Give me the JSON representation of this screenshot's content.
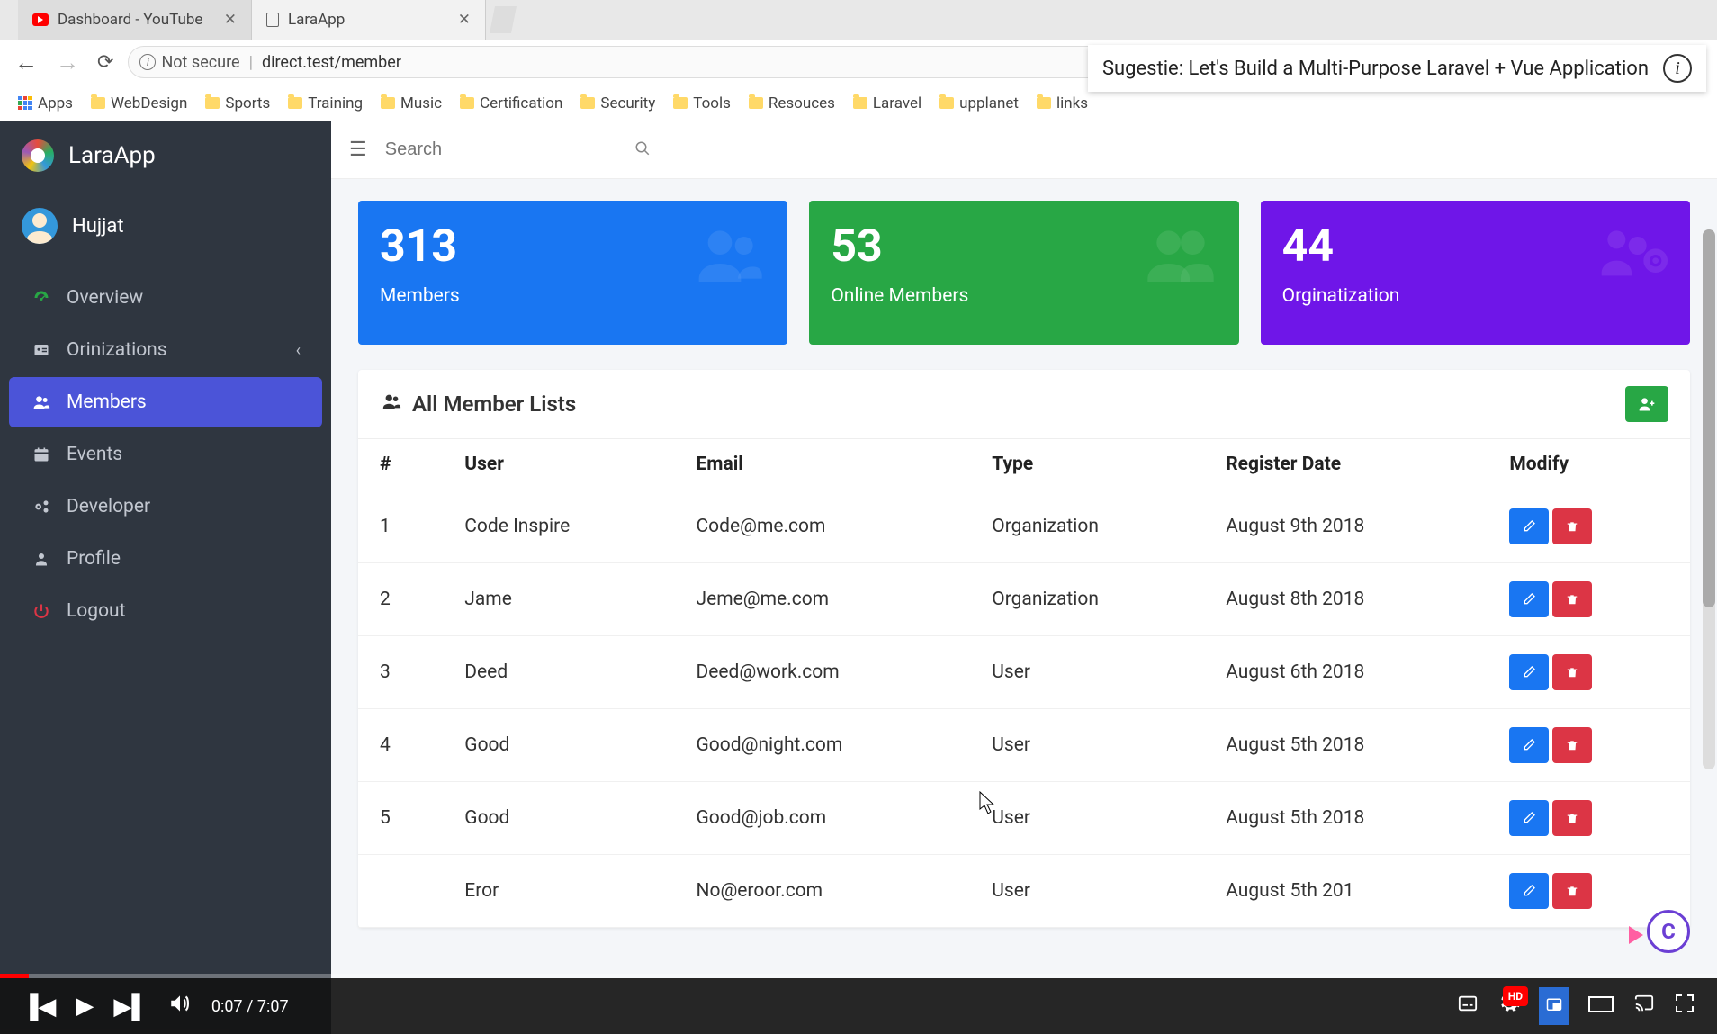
{
  "browser": {
    "tabs": [
      {
        "title": "Dashboard - YouTube",
        "icon": "youtube"
      },
      {
        "title": "LaraApp",
        "icon": "page"
      }
    ],
    "not_secure_label": "Not secure",
    "url": "direct.test/member",
    "suggestion": "Sugestie: Let's Build a Multi-Purpose Laravel + Vue Application"
  },
  "bookmarks": {
    "apps_label": "Apps",
    "items": [
      "WebDesign",
      "Sports",
      "Training",
      "Music",
      "Certification",
      "Security",
      "Tools",
      "Resouces",
      "Laravel",
      "upplanet",
      "links"
    ]
  },
  "app": {
    "brand": "LaraApp",
    "user_name": "Hujjat",
    "search_placeholder": "Search",
    "nav": [
      {
        "label": "Overview",
        "icon": "dashboard"
      },
      {
        "label": "Orinizations",
        "icon": "id-card",
        "expandable": true
      },
      {
        "label": "Members",
        "icon": "users",
        "active": true
      },
      {
        "label": "Events",
        "icon": "calendar"
      },
      {
        "label": "Developer",
        "icon": "cogs"
      },
      {
        "label": "Profile",
        "icon": "user"
      },
      {
        "label": "Logout",
        "icon": "power"
      }
    ],
    "cards": [
      {
        "value": "313",
        "label": "Members",
        "color": "blue"
      },
      {
        "value": "53",
        "label": "Online Members",
        "color": "green"
      },
      {
        "value": "44",
        "label": "Orginatization",
        "color": "purple"
      }
    ],
    "table": {
      "title": "All Member Lists",
      "columns": [
        "#",
        "User",
        "Email",
        "Type",
        "Register Date",
        "Modify"
      ],
      "rows": [
        {
          "n": "1",
          "user": "Code Inspire",
          "email": "Code@me.com",
          "type": "Organization",
          "date": "August 9th 2018"
        },
        {
          "n": "2",
          "user": "Jame",
          "email": "Jeme@me.com",
          "type": "Organization",
          "date": "August 8th 2018"
        },
        {
          "n": "3",
          "user": "Deed",
          "email": "Deed@work.com",
          "type": "User",
          "date": "August 6th 2018"
        },
        {
          "n": "4",
          "user": "Good",
          "email": "Good@night.com",
          "type": "User",
          "date": "August 5th 2018"
        },
        {
          "n": "5",
          "user": "Good",
          "email": "Good@job.com",
          "type": "User",
          "date": "August 5th 2018"
        },
        {
          "n": "",
          "user": "Eror",
          "email": "No@eroor.com",
          "type": "User",
          "date": "August 5th 201"
        }
      ]
    }
  },
  "player": {
    "current": "0:07",
    "total": "7:07",
    "hd_label": "HD"
  }
}
